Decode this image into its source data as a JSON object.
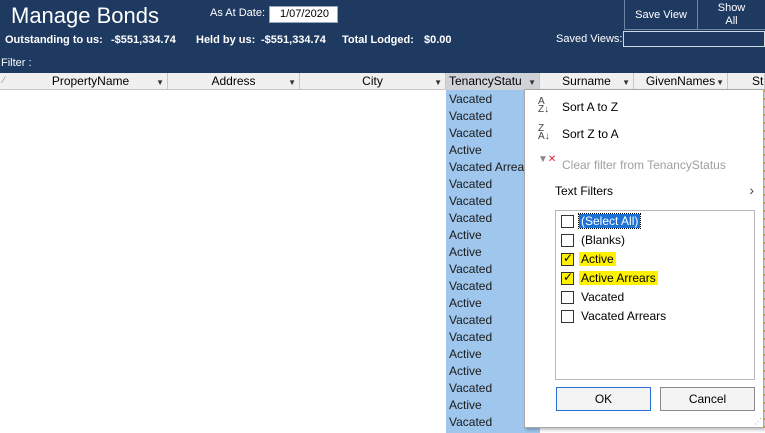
{
  "header": {
    "title": "Manage Bonds",
    "as_at_label": "As At Date:",
    "as_at_value": "1/07/2020",
    "outstanding_label": "Outstanding to us:",
    "outstanding_value": "-$551,334.74",
    "held_label": "Held by us:",
    "held_value": "-$551,334.74",
    "lodged_label": "Total Lodged:",
    "lodged_value": "$0.00",
    "save_view_label": "Save View",
    "show_all_label_1": "Show",
    "show_all_label_2": "All",
    "saved_views_label": "Saved Views:",
    "filter_label": "Filter :"
  },
  "columns": [
    "PropertyName",
    "Address",
    "City",
    "TenancyStatu",
    "Surname",
    "GivenNames",
    "Star"
  ],
  "tenancy_values": [
    "Vacated",
    "Vacated",
    "Vacated",
    "Active",
    "Vacated Arrears",
    "Vacated",
    "Vacated",
    "Vacated",
    "Active",
    "Active",
    "Vacated",
    "Vacated",
    "Active",
    "Vacated",
    "Vacated",
    "Active",
    "Active",
    "Vacated",
    "Active",
    "Vacated"
  ],
  "dropdown": {
    "sort_az": "Sort A to Z",
    "sort_za": "Sort Z to A",
    "clear_filter": "Clear filter from TenancyStatus",
    "text_filters": "Text Filters",
    "options": [
      {
        "label": "(Select All)",
        "checked": false
      },
      {
        "label": "(Blanks)",
        "checked": false
      },
      {
        "label": "Active",
        "checked": true
      },
      {
        "label": "Active Arrears",
        "checked": true
      },
      {
        "label": "Vacated",
        "checked": false
      },
      {
        "label": "Vacated Arrears",
        "checked": false
      }
    ],
    "ok_label": "OK",
    "cancel_label": "Cancel"
  },
  "colors": {
    "header_bg": "#1f3a60",
    "selected_column": "#9fc6ec",
    "highlight": "#fff200",
    "selection": "#1e74d6"
  }
}
